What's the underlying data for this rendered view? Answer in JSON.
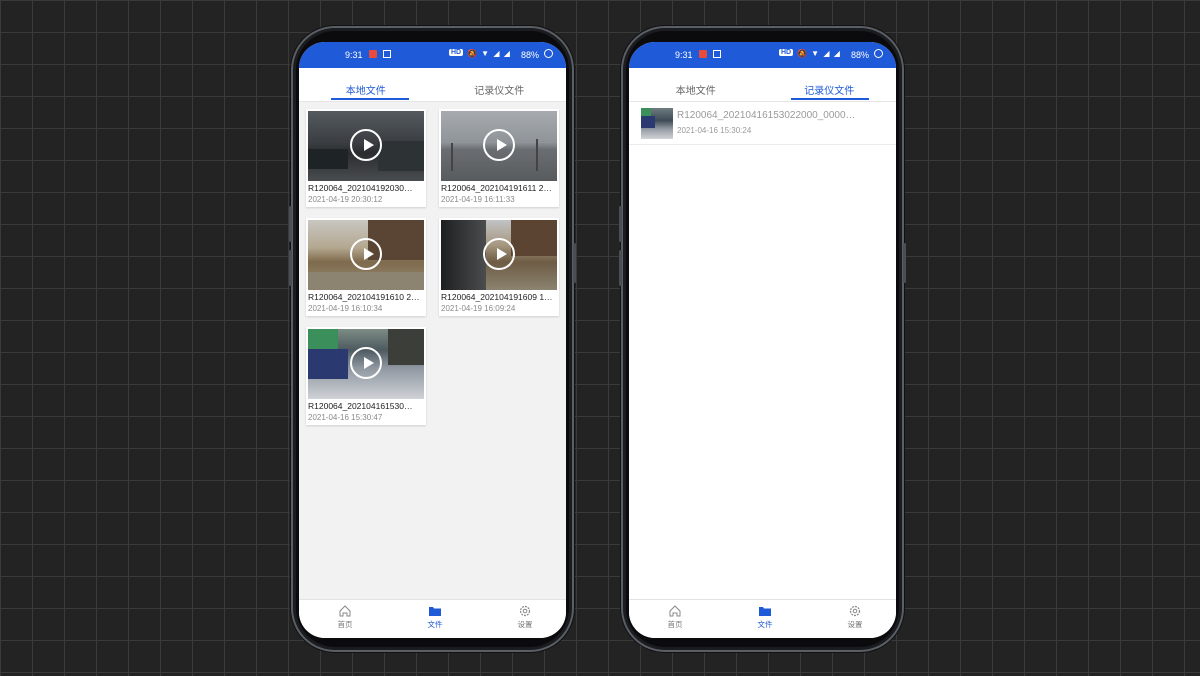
{
  "status_bar": {
    "time": "9:31",
    "hd": "HD",
    "battery": "88%"
  },
  "tabs": {
    "local": "本地文件",
    "recorder": "记录仪文件"
  },
  "local_files": [
    {
      "name": "R120064_202104192030…",
      "date": "2021-04-19 20:30:12"
    },
    {
      "name": "R120064_202104191611 2…",
      "date": "2021-04-19 16:11:33"
    },
    {
      "name": "R120064_202104191610 2…",
      "date": "2021-04-19 16:10:34"
    },
    {
      "name": "R120064_202104191609 1…",
      "date": "2021-04-19 16:09:24"
    },
    {
      "name": "R120064_202104161530…",
      "date": "2021-04-16 15:30:47"
    }
  ],
  "recorder_files": [
    {
      "name": "R120064_20210416153022000_0000…",
      "date": "2021-04-16 15:30:24"
    }
  ],
  "bottom_nav": {
    "home": "首页",
    "files": "文件",
    "settings": "设置"
  },
  "colors": {
    "accent": "#1f5ad8"
  }
}
